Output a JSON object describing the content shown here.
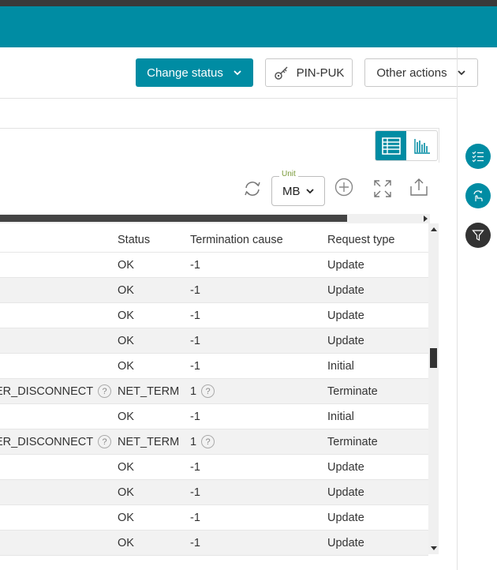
{
  "header": {
    "accent_color": "#008ca3"
  },
  "actions": {
    "change_status": "Change status",
    "pin_puk": "PIN-PUK",
    "other_actions": "Other actions"
  },
  "toolbar": {
    "unit_label": "Unit",
    "unit_value": "MB",
    "icons": [
      "table-view-icon",
      "chart-view-icon",
      "refresh-icon",
      "add-circle-icon",
      "expand-icon",
      "export-icon"
    ]
  },
  "table": {
    "columns": {
      "cause": "",
      "status": "Status",
      "termination_cause": "Termination cause",
      "request_type": "Request type"
    },
    "rows": [
      {
        "cause": "",
        "status": "OK",
        "termination_cause": "-1",
        "request_type": "Update"
      },
      {
        "cause": "",
        "status": "OK",
        "termination_cause": "-1",
        "request_type": "Update"
      },
      {
        "cause": "",
        "status": "OK",
        "termination_cause": "-1",
        "request_type": "Update"
      },
      {
        "cause": "",
        "status": "OK",
        "termination_cause": "-1",
        "request_type": "Update"
      },
      {
        "cause": "",
        "status": "OK",
        "termination_cause": "-1",
        "request_type": "Initial"
      },
      {
        "cause": "ER_DISCONNECT",
        "status": "NET_TERM",
        "termination_cause": "1",
        "request_type": "Terminate"
      },
      {
        "cause": "",
        "status": "OK",
        "termination_cause": "-1",
        "request_type": "Initial"
      },
      {
        "cause": "ER_DISCONNECT",
        "status": "NET_TERM",
        "termination_cause": "1",
        "request_type": "Terminate"
      },
      {
        "cause": "",
        "status": "OK",
        "termination_cause": "-1",
        "request_type": "Update"
      },
      {
        "cause": "",
        "status": "OK",
        "termination_cause": "-1",
        "request_type": "Update"
      },
      {
        "cause": "",
        "status": "OK",
        "termination_cause": "-1",
        "request_type": "Update"
      },
      {
        "cause": "",
        "status": "OK",
        "termination_cause": "-1",
        "request_type": "Update"
      }
    ]
  },
  "sidebar": {
    "buttons": [
      "checklist-icon",
      "hand-refresh-icon",
      "filter-icon"
    ]
  }
}
